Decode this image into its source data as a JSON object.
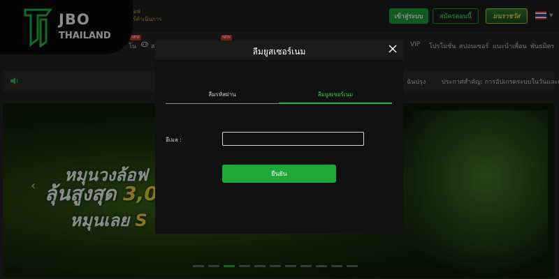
{
  "brand": {
    "name": "JBO",
    "region": "THAILAND"
  },
  "header": {
    "subtitle_line1": "ทคอฟ",
    "subtitle_line2": "ขอร์ดำเนินการ",
    "login_label": "เข้าสู่ระบบ",
    "register_label": "สมัครตอนนี้",
    "promo_label": "มนราชวัส",
    "language_flag": "th-flag-icon"
  },
  "nav": {
    "new_badge": "NEW",
    "items": [
      {
        "label": "โน"
      },
      {
        "label": "ส"
      },
      {
        "label": "VIP"
      },
      {
        "label": "โปรโมชั่น"
      },
      {
        "label": "สปอนเซอร์"
      },
      {
        "label": "แนะนำเพื่อน"
      },
      {
        "label": "พันธมิตร"
      }
    ]
  },
  "announcement": {
    "text_start": "ฉันปรุง",
    "text": "ประกาศสำคัญ: การอัปเกรดระบบในวันและเวลา"
  },
  "banner": {
    "line1": "หมุนวงล้อฟ",
    "line2_prefix": "ลุ้นสูงสุด ",
    "line2_highlight": "3,0",
    "line3_prefix": "หมุนเลย ",
    "line3_highlight": "S",
    "slide_count": 11,
    "active_slide": 3
  },
  "modal": {
    "title": "ลืมยูสเซอร์เนม",
    "tabs": [
      {
        "label": "ลืมรหัสผ่าน",
        "active": false
      },
      {
        "label": "ลืมยูสเซอร์เนม",
        "active": true
      }
    ],
    "email_label": "อีเมล :",
    "email_value": "",
    "confirm_label": "ยืนยัน"
  },
  "colors": {
    "accent_green": "#1ea838",
    "gold": "#ffd23a"
  }
}
